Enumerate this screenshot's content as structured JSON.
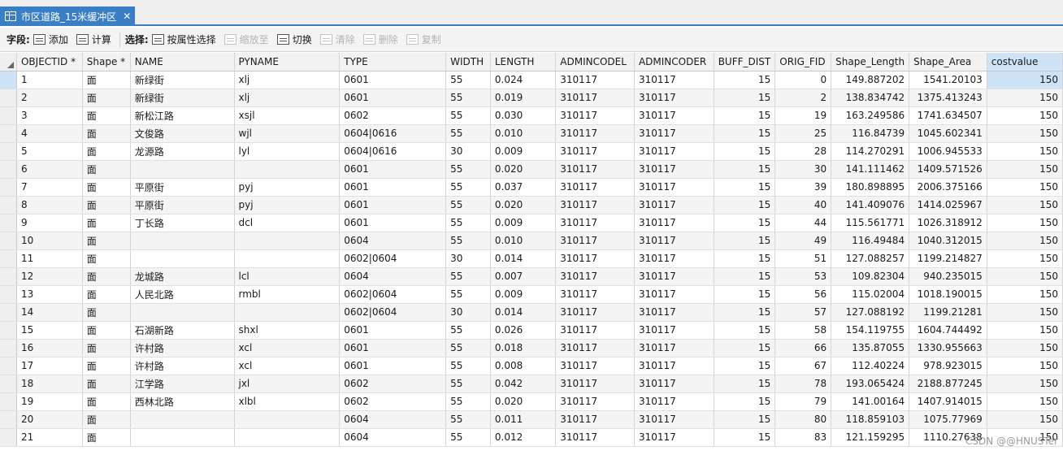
{
  "tab": {
    "label": "市区道路_15米缓冲区",
    "close": "✕"
  },
  "toolbar": {
    "field_label": "字段:",
    "add": "添加",
    "calculate": "计算",
    "select_label": "选择:",
    "select_by_attr": "按属性选择",
    "zoom_to": "缩放至",
    "switch": "切换",
    "clear": "清除",
    "delete": "删除",
    "copy": "复制"
  },
  "columns": [
    "OBJECTID *",
    "Shape *",
    "NAME",
    "PYNAME",
    "TYPE",
    "WIDTH",
    "LENGTH",
    "ADMINCODEL",
    "ADMINCODER",
    "BUFF_DIST",
    "ORIG_FID",
    "Shape_Length",
    "Shape_Area",
    "costvalue"
  ],
  "rows": [
    [
      "1",
      "面",
      "新绿街",
      "xlj",
      "0601",
      "55",
      "0.024",
      "310117",
      "310117",
      "15",
      "0",
      "149.887202",
      "1541.20103",
      "150"
    ],
    [
      "2",
      "面",
      "新绿街",
      "xlj",
      "0601",
      "55",
      "0.019",
      "310117",
      "310117",
      "15",
      "2",
      "138.834742",
      "1375.413243",
      "150"
    ],
    [
      "3",
      "面",
      "新松江路",
      "xsjl",
      "0602",
      "55",
      "0.030",
      "310117",
      "310117",
      "15",
      "19",
      "163.249586",
      "1741.634507",
      "150"
    ],
    [
      "4",
      "面",
      "文俊路",
      "wjl",
      "0604|0616",
      "55",
      "0.010",
      "310117",
      "310117",
      "15",
      "25",
      "116.84739",
      "1045.602341",
      "150"
    ],
    [
      "5",
      "面",
      "龙源路",
      "lyl",
      "0604|0616",
      "30",
      "0.009",
      "310117",
      "310117",
      "15",
      "28",
      "114.270291",
      "1006.945533",
      "150"
    ],
    [
      "6",
      "面",
      "",
      "",
      "0601",
      "55",
      "0.020",
      "310117",
      "310117",
      "15",
      "30",
      "141.111462",
      "1409.571526",
      "150"
    ],
    [
      "7",
      "面",
      "平原街",
      "pyj",
      "0601",
      "55",
      "0.037",
      "310117",
      "310117",
      "15",
      "39",
      "180.898895",
      "2006.375166",
      "150"
    ],
    [
      "8",
      "面",
      "平原街",
      "pyj",
      "0601",
      "55",
      "0.020",
      "310117",
      "310117",
      "15",
      "40",
      "141.409076",
      "1414.025967",
      "150"
    ],
    [
      "9",
      "面",
      "丁长路",
      "dcl",
      "0601",
      "55",
      "0.009",
      "310117",
      "310117",
      "15",
      "44",
      "115.561771",
      "1026.318912",
      "150"
    ],
    [
      "10",
      "面",
      "",
      "",
      "0604",
      "55",
      "0.010",
      "310117",
      "310117",
      "15",
      "49",
      "116.49484",
      "1040.312015",
      "150"
    ],
    [
      "11",
      "面",
      "",
      "",
      "0602|0604",
      "30",
      "0.014",
      "310117",
      "310117",
      "15",
      "51",
      "127.088257",
      "1199.214827",
      "150"
    ],
    [
      "12",
      "面",
      "龙城路",
      "lcl",
      "0604",
      "55",
      "0.007",
      "310117",
      "310117",
      "15",
      "53",
      "109.82304",
      "940.235015",
      "150"
    ],
    [
      "13",
      "面",
      "人民北路",
      "rmbl",
      "0602|0604",
      "55",
      "0.009",
      "310117",
      "310117",
      "15",
      "56",
      "115.02004",
      "1018.190015",
      "150"
    ],
    [
      "14",
      "面",
      "",
      "",
      "0602|0604",
      "30",
      "0.014",
      "310117",
      "310117",
      "15",
      "57",
      "127.088192",
      "1199.21281",
      "150"
    ],
    [
      "15",
      "面",
      "石湖新路",
      "shxl",
      "0601",
      "55",
      "0.026",
      "310117",
      "310117",
      "15",
      "58",
      "154.119755",
      "1604.744492",
      "150"
    ],
    [
      "16",
      "面",
      "许村路",
      "xcl",
      "0601",
      "55",
      "0.018",
      "310117",
      "310117",
      "15",
      "66",
      "135.87055",
      "1330.955663",
      "150"
    ],
    [
      "17",
      "面",
      "许村路",
      "xcl",
      "0601",
      "55",
      "0.008",
      "310117",
      "310117",
      "15",
      "67",
      "112.40224",
      "978.923015",
      "150"
    ],
    [
      "18",
      "面",
      "江学路",
      "jxl",
      "0602",
      "55",
      "0.042",
      "310117",
      "310117",
      "15",
      "78",
      "193.065424",
      "2188.877245",
      "150"
    ],
    [
      "19",
      "面",
      "西林北路",
      "xlbl",
      "0602",
      "55",
      "0.020",
      "310117",
      "310117",
      "15",
      "79",
      "141.00164",
      "1407.914015",
      "150"
    ],
    [
      "20",
      "面",
      "",
      "",
      "0604",
      "55",
      "0.011",
      "310117",
      "310117",
      "15",
      "80",
      "118.859103",
      "1075.77969",
      "150"
    ],
    [
      "21",
      "面",
      "",
      "",
      "0604",
      "55",
      "0.012",
      "310117",
      "310117",
      "15",
      "83",
      "121.159295",
      "1110.27638",
      "150"
    ]
  ],
  "watermark": "CSDN @@HNUSTer",
  "colors": {
    "accent": "#3a7fc5",
    "selection": "#cfe3f7"
  }
}
